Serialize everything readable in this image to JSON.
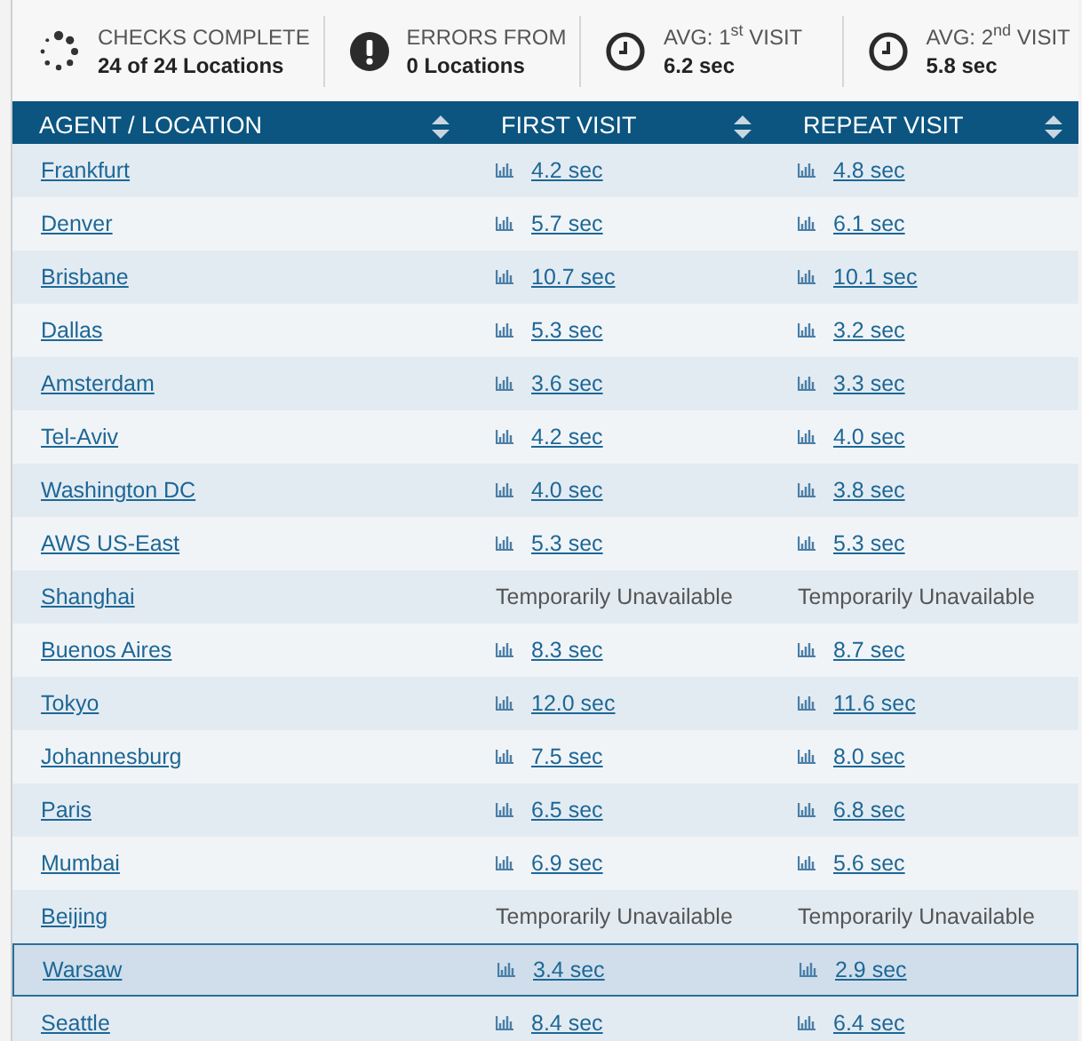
{
  "summary": [
    {
      "kind": "progress",
      "label": "CHECKS COMPLETE",
      "value": "24 of 24 Locations"
    },
    {
      "kind": "error",
      "label": "ERRORS FROM",
      "value": "0 Locations"
    },
    {
      "kind": "clock",
      "label": "AVG: 1$^{st}$ VISIT",
      "value": "6.2 sec"
    },
    {
      "kind": "clock",
      "label": "AVG: 2$^{nd}$ VISIT",
      "value": "5.8 sec"
    }
  ],
  "table": {
    "columns": [
      {
        "label": "AGENT / LOCATION"
      },
      {
        "label": "FIRST VISIT"
      },
      {
        "label": "REPEAT VISIT"
      }
    ],
    "rows": [
      {
        "location": "Frankfurt",
        "selected": false,
        "first_visit": {
          "kind": "timing",
          "text": "4.2 sec"
        },
        "repeat_visit": {
          "kind": "timing",
          "text": "4.8 sec"
        }
      },
      {
        "location": "Denver",
        "selected": false,
        "first_visit": {
          "kind": "timing",
          "text": "5.7 sec"
        },
        "repeat_visit": {
          "kind": "timing",
          "text": "6.1 sec"
        }
      },
      {
        "location": "Brisbane",
        "selected": false,
        "first_visit": {
          "kind": "timing",
          "text": "10.7 sec"
        },
        "repeat_visit": {
          "kind": "timing",
          "text": "10.1 sec"
        }
      },
      {
        "location": "Dallas",
        "selected": false,
        "first_visit": {
          "kind": "timing",
          "text": "5.3 sec"
        },
        "repeat_visit": {
          "kind": "timing",
          "text": "3.2 sec"
        }
      },
      {
        "location": "Amsterdam",
        "selected": false,
        "first_visit": {
          "kind": "timing",
          "text": "3.6 sec"
        },
        "repeat_visit": {
          "kind": "timing",
          "text": "3.3 sec"
        }
      },
      {
        "location": "Tel-Aviv",
        "selected": false,
        "first_visit": {
          "kind": "timing",
          "text": "4.2 sec"
        },
        "repeat_visit": {
          "kind": "timing",
          "text": "4.0 sec"
        }
      },
      {
        "location": "Washington DC",
        "selected": false,
        "first_visit": {
          "kind": "timing",
          "text": "4.0 sec"
        },
        "repeat_visit": {
          "kind": "timing",
          "text": "3.8 sec"
        }
      },
      {
        "location": "AWS US-East",
        "selected": false,
        "first_visit": {
          "kind": "timing",
          "text": "5.3 sec"
        },
        "repeat_visit": {
          "kind": "timing",
          "text": "5.3 sec"
        }
      },
      {
        "location": "Shanghai",
        "selected": false,
        "first_visit": {
          "kind": "unavailable",
          "text": "Temporarily Unavailable"
        },
        "repeat_visit": {
          "kind": "unavailable",
          "text": "Temporarily Unavailable"
        }
      },
      {
        "location": "Buenos Aires",
        "selected": false,
        "first_visit": {
          "kind": "timing",
          "text": "8.3 sec"
        },
        "repeat_visit": {
          "kind": "timing",
          "text": "8.7 sec"
        }
      },
      {
        "location": "Tokyo",
        "selected": false,
        "first_visit": {
          "kind": "timing",
          "text": "12.0 sec"
        },
        "repeat_visit": {
          "kind": "timing",
          "text": "11.6 sec"
        }
      },
      {
        "location": "Johannesburg",
        "selected": false,
        "first_visit": {
          "kind": "timing",
          "text": "7.5 sec"
        },
        "repeat_visit": {
          "kind": "timing",
          "text": "8.0 sec"
        }
      },
      {
        "location": "Paris",
        "selected": false,
        "first_visit": {
          "kind": "timing",
          "text": "6.5 sec"
        },
        "repeat_visit": {
          "kind": "timing",
          "text": "6.8 sec"
        }
      },
      {
        "location": "Mumbai",
        "selected": false,
        "first_visit": {
          "kind": "timing",
          "text": "6.9 sec"
        },
        "repeat_visit": {
          "kind": "timing",
          "text": "5.6 sec"
        }
      },
      {
        "location": "Beijing",
        "selected": false,
        "first_visit": {
          "kind": "unavailable",
          "text": "Temporarily Unavailable"
        },
        "repeat_visit": {
          "kind": "unavailable",
          "text": "Temporarily Unavailable"
        }
      },
      {
        "location": "Warsaw",
        "selected": true,
        "first_visit": {
          "kind": "timing",
          "text": "3.4 sec"
        },
        "repeat_visit": {
          "kind": "timing",
          "text": "2.9 sec"
        }
      },
      {
        "location": "Seattle",
        "selected": false,
        "first_visit": {
          "kind": "timing",
          "text": "8.4 sec"
        },
        "repeat_visit": {
          "kind": "timing",
          "text": "6.4 sec"
        }
      }
    ]
  }
}
